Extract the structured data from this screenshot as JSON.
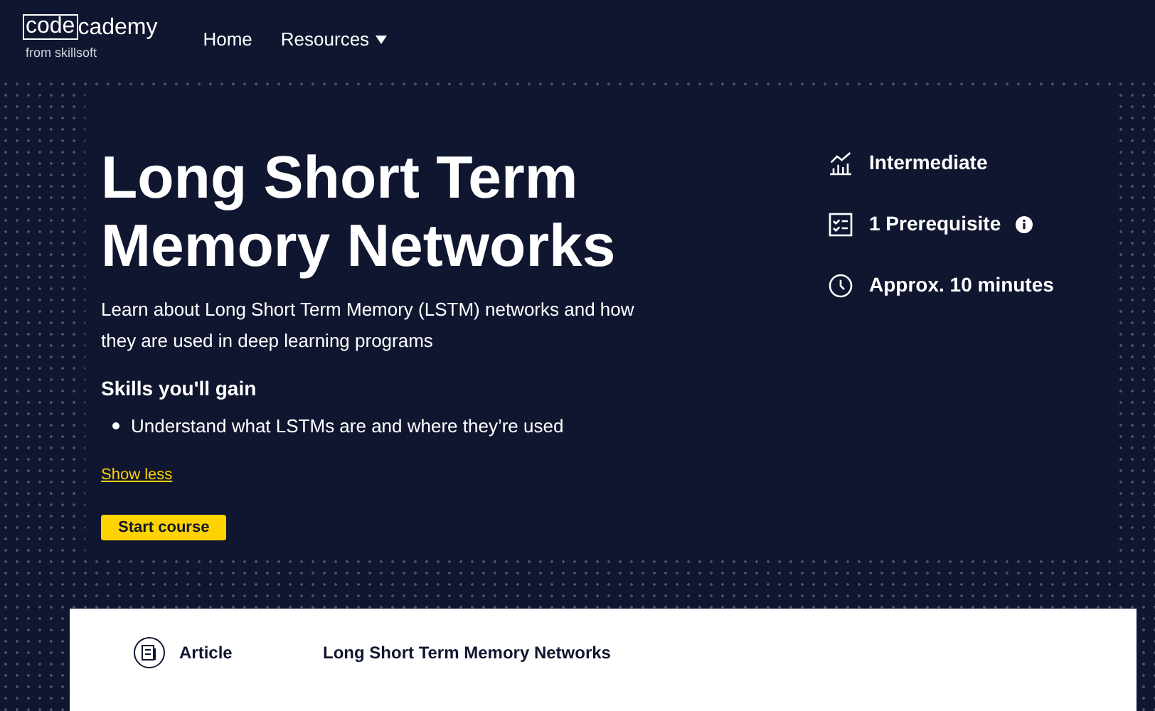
{
  "logo": {
    "boxed": "code",
    "rest": "cademy",
    "tagline": "from skillsoft"
  },
  "nav": [
    {
      "label": "Home",
      "kind": "link"
    },
    {
      "label": "Resources",
      "kind": "dropdown"
    }
  ],
  "hero": {
    "title": "Long Short Term Memory Networks",
    "description": "Learn about Long Short Term Memory (LSTM) networks and how they are used in deep learning programs",
    "skills_heading": "Skills you'll gain",
    "skills": [
      "Understand what LSTMs are and where they’re used"
    ],
    "toggle": "Show less",
    "button": "Start course"
  },
  "facts": [
    {
      "kind": "level",
      "label": "Intermediate",
      "info": false
    },
    {
      "kind": "prerequisite",
      "label": "1 Prerequisite",
      "info": true
    },
    {
      "kind": "time",
      "label": "Approx. 10 minutes",
      "info": false
    }
  ],
  "syllabus": [
    {
      "type": "Article",
      "title": "Long Short Term Memory Networks"
    }
  ]
}
